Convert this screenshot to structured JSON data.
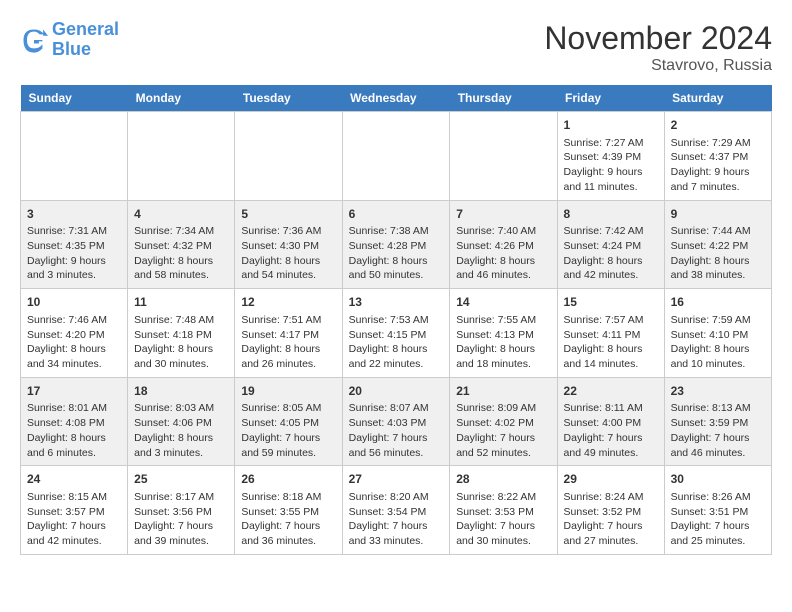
{
  "logo": {
    "line1": "General",
    "line2": "Blue"
  },
  "title": "November 2024",
  "location": "Stavrovo, Russia",
  "days_of_week": [
    "Sunday",
    "Monday",
    "Tuesday",
    "Wednesday",
    "Thursday",
    "Friday",
    "Saturday"
  ],
  "weeks": [
    [
      {
        "day": "",
        "content": ""
      },
      {
        "day": "",
        "content": ""
      },
      {
        "day": "",
        "content": ""
      },
      {
        "day": "",
        "content": ""
      },
      {
        "day": "",
        "content": ""
      },
      {
        "day": "1",
        "content": "Sunrise: 7:27 AM\nSunset: 4:39 PM\nDaylight: 9 hours and 11 minutes."
      },
      {
        "day": "2",
        "content": "Sunrise: 7:29 AM\nSunset: 4:37 PM\nDaylight: 9 hours and 7 minutes."
      }
    ],
    [
      {
        "day": "3",
        "content": "Sunrise: 7:31 AM\nSunset: 4:35 PM\nDaylight: 9 hours and 3 minutes."
      },
      {
        "day": "4",
        "content": "Sunrise: 7:34 AM\nSunset: 4:32 PM\nDaylight: 8 hours and 58 minutes."
      },
      {
        "day": "5",
        "content": "Sunrise: 7:36 AM\nSunset: 4:30 PM\nDaylight: 8 hours and 54 minutes."
      },
      {
        "day": "6",
        "content": "Sunrise: 7:38 AM\nSunset: 4:28 PM\nDaylight: 8 hours and 50 minutes."
      },
      {
        "day": "7",
        "content": "Sunrise: 7:40 AM\nSunset: 4:26 PM\nDaylight: 8 hours and 46 minutes."
      },
      {
        "day": "8",
        "content": "Sunrise: 7:42 AM\nSunset: 4:24 PM\nDaylight: 8 hours and 42 minutes."
      },
      {
        "day": "9",
        "content": "Sunrise: 7:44 AM\nSunset: 4:22 PM\nDaylight: 8 hours and 38 minutes."
      }
    ],
    [
      {
        "day": "10",
        "content": "Sunrise: 7:46 AM\nSunset: 4:20 PM\nDaylight: 8 hours and 34 minutes."
      },
      {
        "day": "11",
        "content": "Sunrise: 7:48 AM\nSunset: 4:18 PM\nDaylight: 8 hours and 30 minutes."
      },
      {
        "day": "12",
        "content": "Sunrise: 7:51 AM\nSunset: 4:17 PM\nDaylight: 8 hours and 26 minutes."
      },
      {
        "day": "13",
        "content": "Sunrise: 7:53 AM\nSunset: 4:15 PM\nDaylight: 8 hours and 22 minutes."
      },
      {
        "day": "14",
        "content": "Sunrise: 7:55 AM\nSunset: 4:13 PM\nDaylight: 8 hours and 18 minutes."
      },
      {
        "day": "15",
        "content": "Sunrise: 7:57 AM\nSunset: 4:11 PM\nDaylight: 8 hours and 14 minutes."
      },
      {
        "day": "16",
        "content": "Sunrise: 7:59 AM\nSunset: 4:10 PM\nDaylight: 8 hours and 10 minutes."
      }
    ],
    [
      {
        "day": "17",
        "content": "Sunrise: 8:01 AM\nSunset: 4:08 PM\nDaylight: 8 hours and 6 minutes."
      },
      {
        "day": "18",
        "content": "Sunrise: 8:03 AM\nSunset: 4:06 PM\nDaylight: 8 hours and 3 minutes."
      },
      {
        "day": "19",
        "content": "Sunrise: 8:05 AM\nSunset: 4:05 PM\nDaylight: 7 hours and 59 minutes."
      },
      {
        "day": "20",
        "content": "Sunrise: 8:07 AM\nSunset: 4:03 PM\nDaylight: 7 hours and 56 minutes."
      },
      {
        "day": "21",
        "content": "Sunrise: 8:09 AM\nSunset: 4:02 PM\nDaylight: 7 hours and 52 minutes."
      },
      {
        "day": "22",
        "content": "Sunrise: 8:11 AM\nSunset: 4:00 PM\nDaylight: 7 hours and 49 minutes."
      },
      {
        "day": "23",
        "content": "Sunrise: 8:13 AM\nSunset: 3:59 PM\nDaylight: 7 hours and 46 minutes."
      }
    ],
    [
      {
        "day": "24",
        "content": "Sunrise: 8:15 AM\nSunset: 3:57 PM\nDaylight: 7 hours and 42 minutes."
      },
      {
        "day": "25",
        "content": "Sunrise: 8:17 AM\nSunset: 3:56 PM\nDaylight: 7 hours and 39 minutes."
      },
      {
        "day": "26",
        "content": "Sunrise: 8:18 AM\nSunset: 3:55 PM\nDaylight: 7 hours and 36 minutes."
      },
      {
        "day": "27",
        "content": "Sunrise: 8:20 AM\nSunset: 3:54 PM\nDaylight: 7 hours and 33 minutes."
      },
      {
        "day": "28",
        "content": "Sunrise: 8:22 AM\nSunset: 3:53 PM\nDaylight: 7 hours and 30 minutes."
      },
      {
        "day": "29",
        "content": "Sunrise: 8:24 AM\nSunset: 3:52 PM\nDaylight: 7 hours and 27 minutes."
      },
      {
        "day": "30",
        "content": "Sunrise: 8:26 AM\nSunset: 3:51 PM\nDaylight: 7 hours and 25 minutes."
      }
    ]
  ]
}
